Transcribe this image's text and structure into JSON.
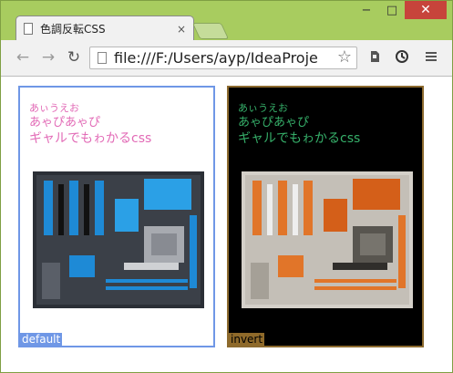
{
  "browser": {
    "tab_title": "色調反転CSS",
    "tab_close": "×",
    "url": "file:///F:/Users/ayp/IdeaProje",
    "controls": {
      "minimize": "−",
      "maximize": "□",
      "close": "✕"
    }
  },
  "panels": [
    {
      "id": "default",
      "label": "default",
      "text_lines": [
        "あぃうえお",
        "あゃぴあゃぴ",
        "ギャルでもゎかるcss"
      ]
    },
    {
      "id": "invert",
      "label": "invert",
      "text_lines": [
        "あぃうえお",
        "あゃぴあゃぴ",
        "ギャルでもゎかるcss"
      ]
    }
  ],
  "colors": {
    "default_border": "#6f97e6",
    "invert_border": "#8c6a2e",
    "default_text": "#e26ab6",
    "invert_text": "#36b06a"
  }
}
